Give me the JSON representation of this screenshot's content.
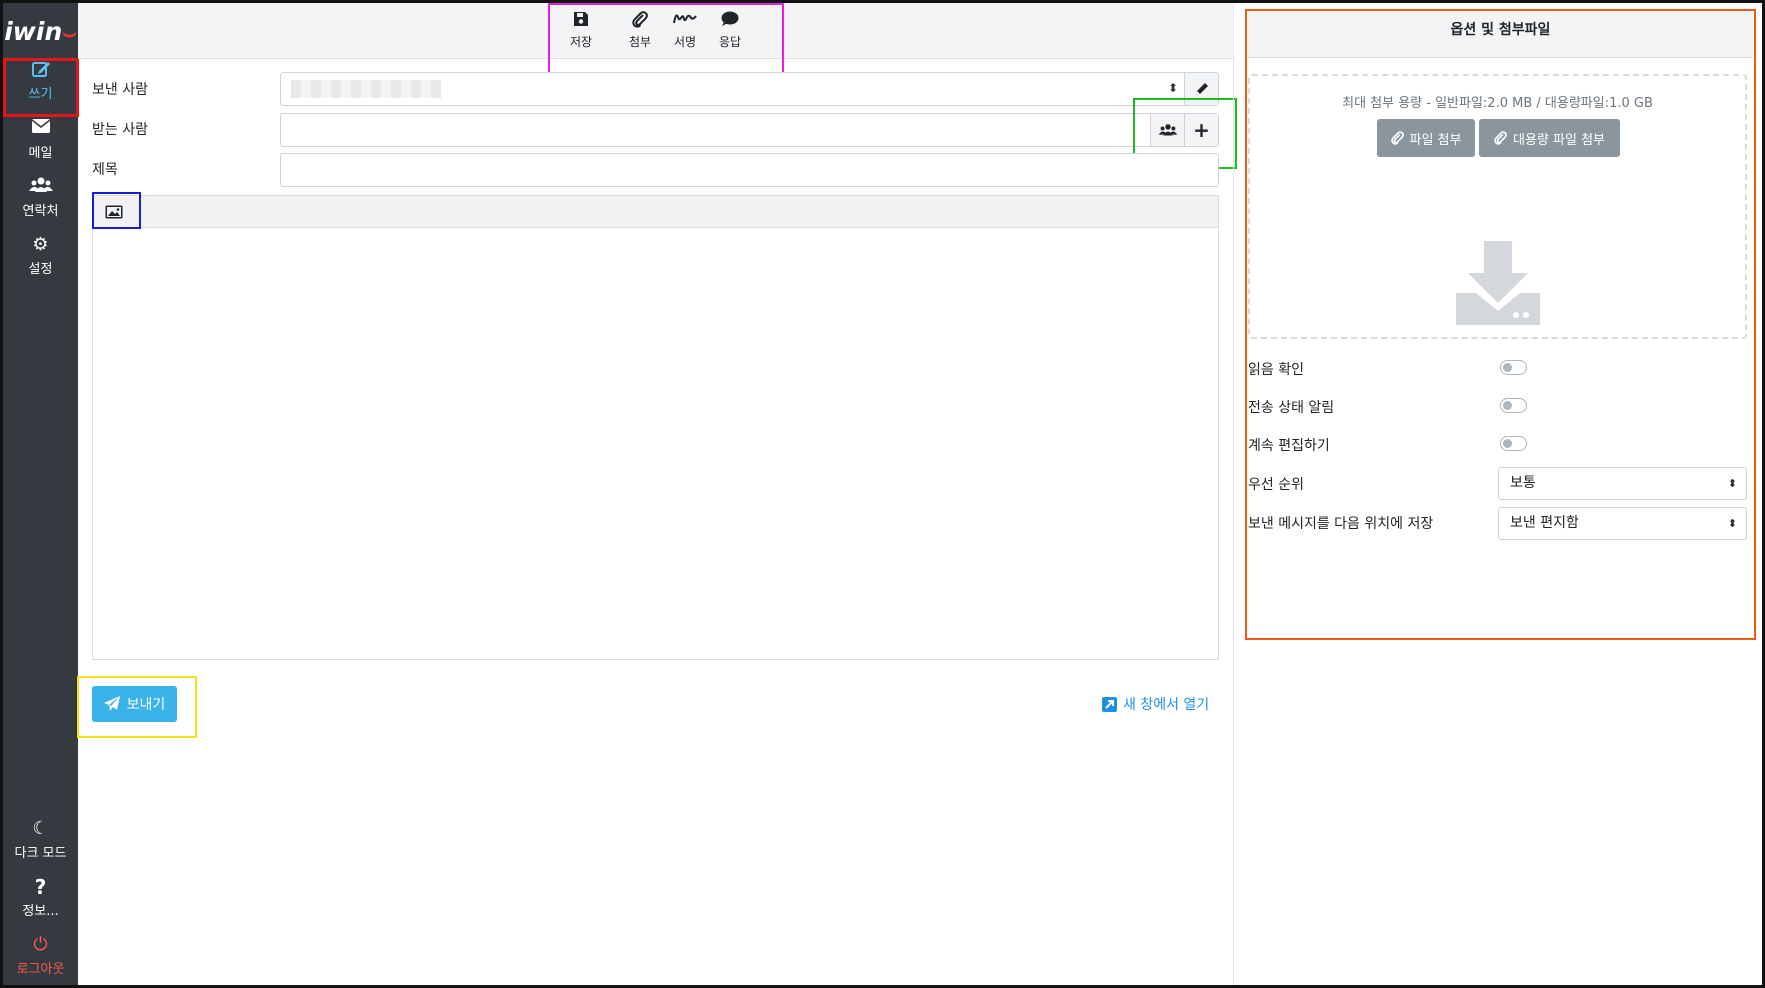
{
  "app": {
    "logo_text": "iwin"
  },
  "sidebar": {
    "items": [
      {
        "label": "쓰기",
        "icon": "compose-icon",
        "active": true
      },
      {
        "label": "메일",
        "icon": "envelope-icon"
      },
      {
        "label": "연락처",
        "icon": "users-icon"
      },
      {
        "label": "설정",
        "icon": "gear-icon"
      }
    ],
    "bottom": [
      {
        "label": "다크 모드",
        "icon": "moon-icon"
      },
      {
        "label": "정보...",
        "icon": "question-icon"
      },
      {
        "label": "로그아웃",
        "icon": "power-icon"
      }
    ]
  },
  "toolbar": {
    "save": "저장",
    "attach": "첨부",
    "signature": "서명",
    "response": "응답"
  },
  "form": {
    "from_label": "보낸 사람",
    "to_label": "받는 사람",
    "subject_label": "제목",
    "to_value": "",
    "subject_value": ""
  },
  "actions": {
    "send": "보내기",
    "open_new_window": "새 창에서 열기"
  },
  "panel": {
    "title": "옵션 및 첨부파일",
    "max_size_text": "최대 첨부 용량 - 일반파일:2.0 MB / 대용량파일:1.0 GB",
    "file_attach": "파일 첨부",
    "large_file_attach": "대용량 파일 첨부",
    "options": {
      "read_receipt": "읽음 확인",
      "delivery_status": "전송 상태 알림",
      "keep_editing": "계속 편집하기",
      "priority_label": "우선 순위",
      "priority_value": "보통",
      "save_sent_label": "보낸 메시지를 다음 위치에 저장",
      "save_sent_value": "보낸 편지함"
    },
    "toggles": {
      "read_receipt": false,
      "delivery_status": false,
      "keep_editing": false
    }
  },
  "colors": {
    "sidebar_bg": "#343a40",
    "accent_blue": "#3ab2ea",
    "logout_red": "#ff5a4f",
    "highlight_red": "#e8141a",
    "highlight_magenta": "#e81ee0",
    "highlight_green": "#1dbb1d",
    "highlight_blue": "#1a1ad6",
    "highlight_yellow": "#f2e21a",
    "highlight_orange": "#f05a12"
  }
}
